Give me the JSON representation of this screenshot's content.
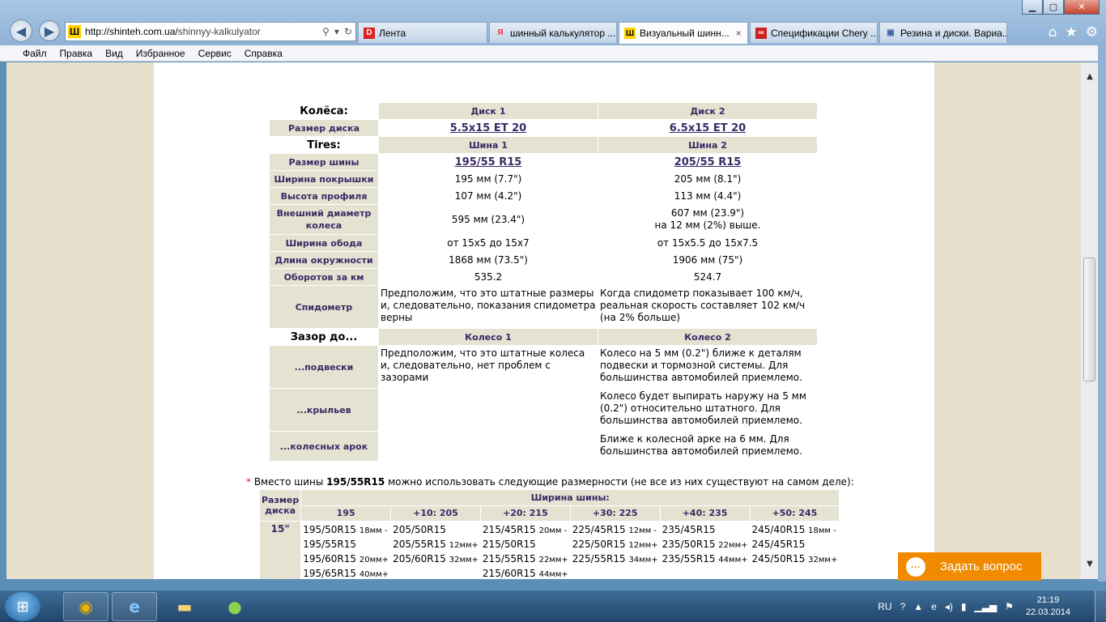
{
  "browser": {
    "url_host": "http://shinteh.com.ua/",
    "url_path": "shinnyy-kalkulyator",
    "tabs": [
      {
        "label": "Лента",
        "icon": "D",
        "color": "#d22"
      },
      {
        "label": "шинный калькулятор ...",
        "icon": "Я",
        "color": "#e33"
      },
      {
        "label": "Визуальный шинн...",
        "icon": "Ш",
        "color": "#ffd200"
      },
      {
        "label": "Спецификации Chery ...",
        "icon": "∞",
        "color": "#c22"
      },
      {
        "label": "Резина и диски. Вариа...",
        "icon": "▣",
        "color": "#3a5fa8"
      }
    ],
    "tab_close": "×",
    "menu": [
      "Файл",
      "Правка",
      "Вид",
      "Избранное",
      "Сервис",
      "Справка"
    ]
  },
  "wheels": {
    "section": "Колёса:",
    "disk1_header": "Диск 1",
    "disk2_header": "Диск 2",
    "rim_label": "Размер диска",
    "rim1": "5.5x15 ET 20",
    "rim2": "6.5x15 ET 20"
  },
  "tires": {
    "section": "Tires:",
    "tire1_header": "Шина 1",
    "tire2_header": "Шина 2",
    "rows": [
      {
        "label": "Размер шины",
        "v1": "195/55 R15",
        "v2": "205/55 R15"
      },
      {
        "label": "Ширина покрышки",
        "v1": "195 мм (7.7\")",
        "v2": "205 мм (8.1\")"
      },
      {
        "label": "Высота профиля",
        "v1": "107 мм (4.2\")",
        "v2": "113 мм (4.4\")"
      },
      {
        "label": "Внешний диаметр колеса",
        "v1": "595 мм (23.4\")",
        "v2": "607 мм (23.9\")",
        "v2b": "на 12 мм (2%) выше."
      },
      {
        "label": "Ширина обода",
        "v1": "от 15x5 до 15x7",
        "v2": "от 15x5.5 до 15x7.5"
      },
      {
        "label": "Длина окружности",
        "v1": "1868 мм (73.5\")",
        "v2": "1906 мм (75\")"
      },
      {
        "label": "Оборотов за км",
        "v1": "535.2",
        "v2": "524.7"
      },
      {
        "label": "Спидометр",
        "v1": "Предположим, что это штатные размеры и, следовательно, показания спидометра верны",
        "v2": "Когда спидометр показывает 100 км/ч, реальная скорость составляет 102 км/ч (на 2% больше)"
      }
    ]
  },
  "clearance": {
    "section": "Зазор до...",
    "wheel1_header": "Колесо 1",
    "wheel2_header": "Колесо 2",
    "wheel1_text": "Предположим, что это штатные колеса и, следовательно, нет проблем с зазорами",
    "rows": [
      {
        "label": "...подвески",
        "v2": "Колесо на 5 мм (0.2\") ближе к деталям подвески и тормозной системы. Для большинства автомобилей приемлемо."
      },
      {
        "label": "...крыльев",
        "v2": "Колесо будет выпирать наружу на 5 мм (0.2\") относительно штатного. Для большинства автомобилей приемлемо."
      },
      {
        "label": "...колесных арок",
        "v2": "Ближе к колесной арке на 6 мм. Для большинства автомобилей приемлемо."
      }
    ]
  },
  "alternatives": {
    "note_star": "*",
    "note_prefix": "Вместо шины",
    "note_tire": "195/55R15",
    "note_suffix": "можно использовать следующие размерности (не все из них существуют на самом деле):",
    "rim_header": "Размер диска",
    "width_header": "Ширина шины:",
    "columns": [
      "195",
      "+10: 205",
      "+20: 215",
      "+30: 225",
      "+40: 235",
      "+50: 245"
    ],
    "rim": "15\"",
    "cells": [
      [
        [
          "195/50R15",
          "18мм -"
        ],
        [
          "195/55R15",
          ""
        ],
        [
          "195/60R15",
          "20мм+"
        ],
        [
          "195/65R15",
          "40мм+"
        ]
      ],
      [
        [
          "205/50R15",
          ""
        ],
        [
          "205/55R15",
          "12мм+"
        ],
        [
          "205/60R15",
          "32мм+"
        ]
      ],
      [
        [
          "215/45R15",
          "20мм -"
        ],
        [
          "215/50R15",
          ""
        ],
        [
          "215/55R15",
          "22мм+"
        ],
        [
          "215/60R15",
          "44мм+"
        ]
      ],
      [
        [
          "225/45R15",
          "12мм -"
        ],
        [
          "225/50R15",
          "12мм+"
        ],
        [
          "225/55R15",
          "34мм+"
        ]
      ],
      [
        [
          "235/45R15",
          ""
        ],
        [
          "235/50R15",
          "22мм+"
        ],
        [
          "235/55R15",
          "44мм+"
        ]
      ],
      [
        [
          "245/40R15",
          "18мм -"
        ],
        [
          "245/45R15",
          ""
        ],
        [
          "245/50R15",
          "32мм+"
        ]
      ]
    ]
  },
  "ask_button": "Задать вопрос",
  "taskbar": {
    "lang": "RU",
    "time": "21:19",
    "date": "22.03.2014"
  }
}
